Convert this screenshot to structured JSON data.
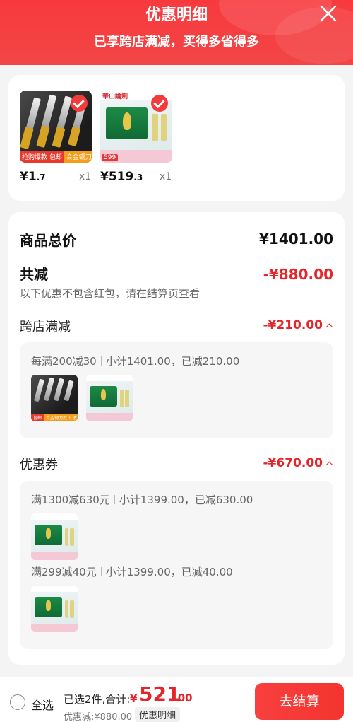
{
  "header": {
    "title": "优惠明细",
    "subtitle": "已享跨店满减，买得多省得多"
  },
  "products": [
    {
      "tag_left": "抢购爆款 包邮",
      "tag_right": "合金钢刀刃 1 把",
      "price_symbol": "¥",
      "price_int": "1",
      "price_dec": ".7",
      "qty": "x1",
      "selected": true
    },
    {
      "brand": "華山論劍",
      "price_badge": "599",
      "price_symbol": "¥",
      "price_int": "519",
      "price_dec": ".3",
      "qty": "x1",
      "selected": true
    }
  ],
  "summary": {
    "total_label": "商品总价",
    "total_value": "¥1401.00",
    "reduce_label": "共减",
    "reduce_value": "-¥880.00",
    "reduce_note": "以下优惠不包含红包，请在结算页查看"
  },
  "cross_store": {
    "label": "跨店满减",
    "value": "-¥210.00",
    "rule": "每满200减30",
    "detail": "小计1401.00，已减210.00"
  },
  "coupons": {
    "label": "优惠券",
    "value": "-¥670.00",
    "items": [
      {
        "rule": "满1300减630元",
        "detail": "小计1399.00，已减630.00"
      },
      {
        "rule": "满299减40元",
        "detail": "小计1399.00，已减40.00"
      }
    ]
  },
  "footer": {
    "select_all": "全选",
    "selected_count": "已选2件,合计:",
    "total_symbol": "¥",
    "total_int": "521",
    "total_dec": ".00",
    "discount_text": "优惠减:¥880.00",
    "detail_button": "优惠明细",
    "checkout_button": "去结算"
  },
  "colors": {
    "accent_red": "#e4262b",
    "header_red": "#f83a3f",
    "checkout_red": "#f4342e"
  }
}
